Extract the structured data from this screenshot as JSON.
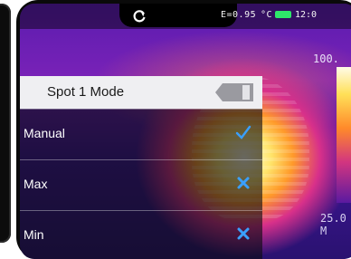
{
  "status_bar": {
    "emissivity": "E=0.95",
    "unit": "°C",
    "time": "12:0",
    "battery_color": "#2ee86a"
  },
  "scale": {
    "max_label": "100.",
    "min_label": "25.0",
    "mode_label": "M"
  },
  "menu": {
    "title": "Spot 1 Mode",
    "items": [
      {
        "label": "Manual",
        "state": "selected",
        "mark_icon": "check-icon",
        "mark_color": "#3aa0ff"
      },
      {
        "label": "Max",
        "state": "unselected",
        "mark_icon": "x-icon",
        "mark_color": "#3aa0ff"
      },
      {
        "label": "Min",
        "state": "unselected",
        "mark_icon": "x-icon",
        "mark_color": "#3aa0ff"
      }
    ]
  },
  "icons": {
    "refresh": "refresh-icon",
    "back": "back-arrow-icon"
  }
}
